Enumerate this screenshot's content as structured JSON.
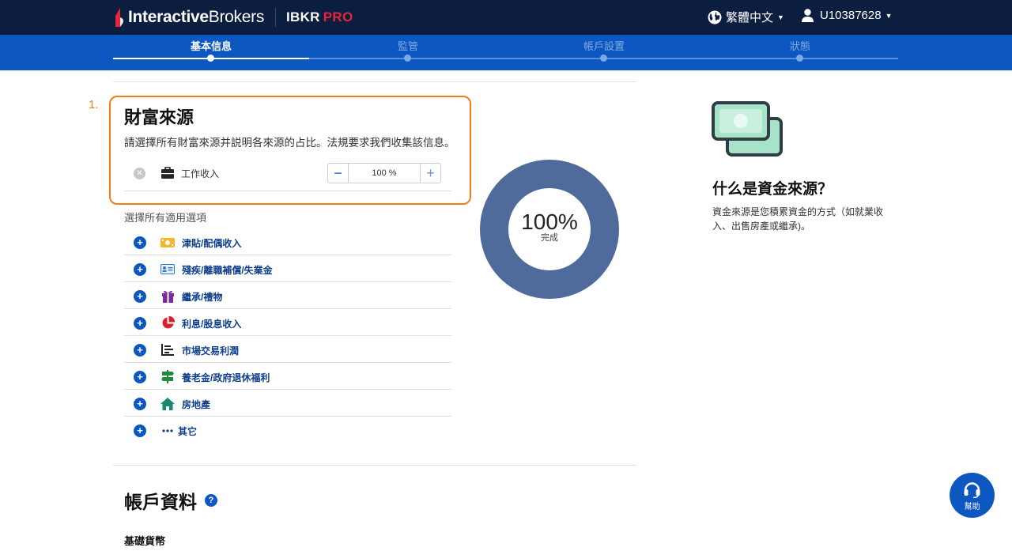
{
  "header": {
    "logo_bold": "Interactive",
    "logo_light": "Brokers",
    "product": "IBKR",
    "product_accent": "PRO",
    "language": "繁體中文",
    "user_id": "U10387628"
  },
  "steps": [
    {
      "label": "基本信息",
      "active": true
    },
    {
      "label": "監管",
      "active": false
    },
    {
      "label": "帳戶設置",
      "active": false
    },
    {
      "label": "狀態",
      "active": false
    }
  ],
  "wealth": {
    "step_number": "1.",
    "title": "財富來源",
    "description": "請選擇所有財富來源并説明各來源的占比。法規要求我們收集該信息。",
    "selected": {
      "icon": "briefcase-icon",
      "label": "工作收入",
      "percent_text": "100 %",
      "percent": 100
    },
    "choose_label": "選擇所有適用選項",
    "options": [
      {
        "icon": "cash-icon",
        "label": "津貼/配偶收入"
      },
      {
        "icon": "id-card-icon",
        "label": "殘疾/離職補償/失業金"
      },
      {
        "icon": "gift-icon",
        "label": "繼承/禮物"
      },
      {
        "icon": "pie-chart-icon",
        "label": "利息/股息收入"
      },
      {
        "icon": "bar-chart-icon",
        "label": "市場交易利潤"
      },
      {
        "icon": "signpost-icon",
        "label": "養老金/政府退休福利"
      },
      {
        "icon": "home-icon",
        "label": "房地產"
      },
      {
        "icon": "more-icon",
        "label": "其它"
      }
    ]
  },
  "donut": {
    "value": "100%",
    "label": "完成",
    "fraction": 1.0,
    "color": "#4e6b9c"
  },
  "info": {
    "title": "什么是資金來源？",
    "text": "資金來源是您積累資金的方式（如就業收入、出售房產或繼承)。"
  },
  "account": {
    "title": "帳戶資料",
    "base_currency_label": "基礎貨幣"
  },
  "help": {
    "label": "幫助"
  },
  "colors": {
    "nav_bg": "#0b1e3f",
    "step_bg": "#0d57c0",
    "accent_orange": "#f07d1a",
    "brand_red": "#e3273a"
  }
}
